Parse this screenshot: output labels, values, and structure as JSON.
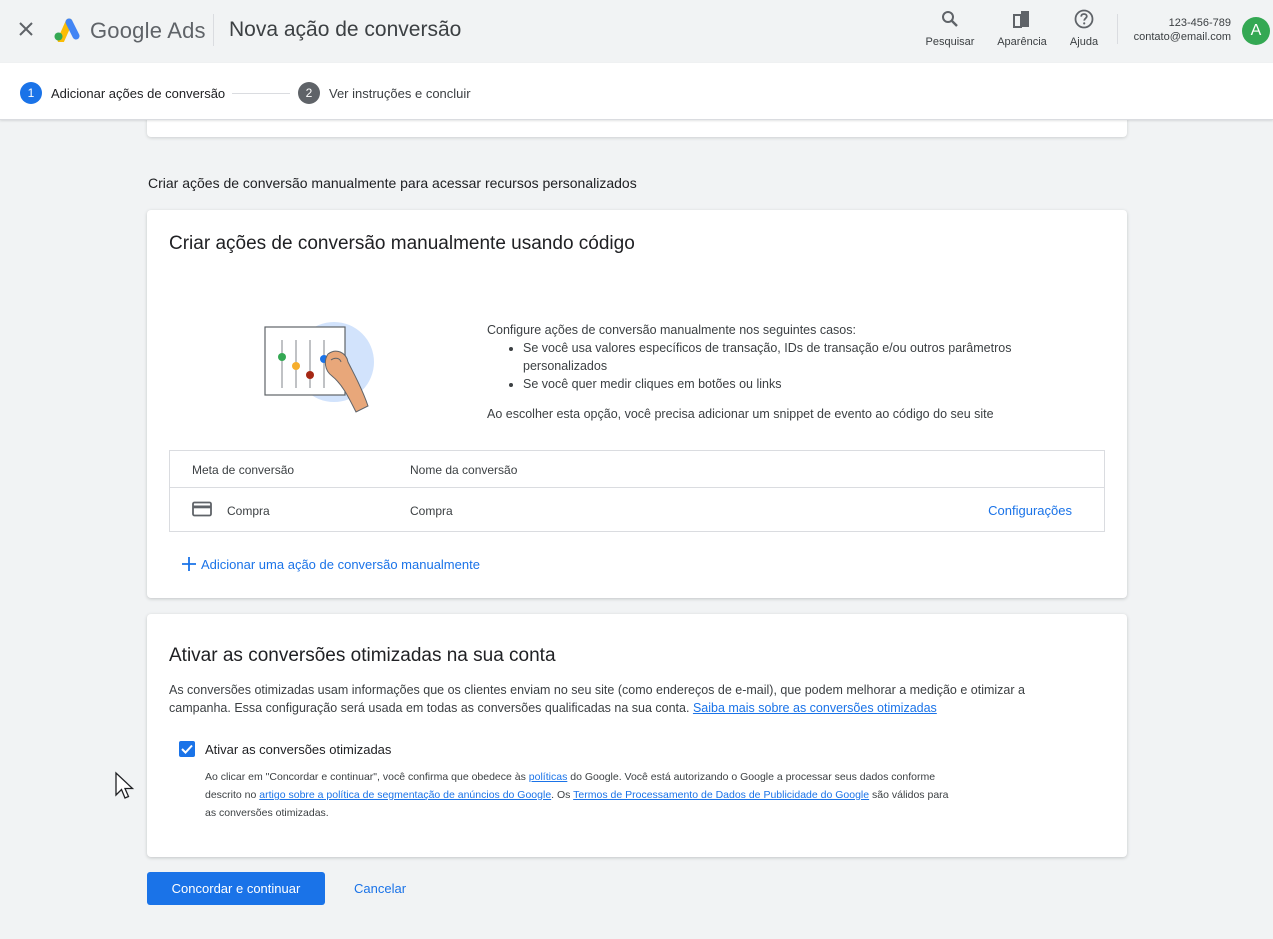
{
  "header": {
    "brand": "Google Ads",
    "page_title": "Nova ação de conversão",
    "tools": [
      {
        "label": "Pesquisar",
        "icon": "search-icon"
      },
      {
        "label": "Aparência",
        "icon": "appearance-icon"
      },
      {
        "label": "Ajuda",
        "icon": "help-icon"
      }
    ],
    "account_id": "123-456-789",
    "account_email": "contato@email.com",
    "avatar_letter": "A"
  },
  "stepper": {
    "steps": [
      {
        "number": "1",
        "label": "Adicionar ações de conversão",
        "active": true
      },
      {
        "number": "2",
        "label": "Ver instruções e concluir",
        "active": false
      }
    ]
  },
  "section_label": "Criar ações de conversão manualmente para acessar recursos personalizados",
  "manual_card": {
    "title": "Criar ações de conversão manualmente usando código",
    "intro": "Configure ações de conversão manualmente nos seguintes casos:",
    "bullets": [
      "Se você usa valores específicos de transação, IDs de transação e/ou outros parâmetros personalizados",
      "Se você quer medir cliques em botões ou links"
    ],
    "note": "Ao escolher esta opção, você precisa adicionar um snippet de evento ao código do seu site",
    "table": {
      "headers": [
        "Meta de conversão",
        "Nome da conversão"
      ],
      "rows": [
        {
          "goal": "Compra",
          "name": "Compra",
          "action": "Configurações",
          "icon": "credit-card-icon"
        }
      ]
    },
    "add_action": "Adicionar uma ação de conversão manualmente"
  },
  "enhanced_card": {
    "title": "Ativar as conversões otimizadas na sua conta",
    "paragraph": "As conversões otimizadas usam informações que os clientes enviam no seu site (como endereços de e-mail), que podem melhorar a medição e otimizar a campanha. Essa configuração será usada em todas as conversões qualificadas na sua conta.",
    "learn_more": "Saiba mais sobre as conversões otimizadas",
    "checkbox_label": "Ativar as conversões otimizadas",
    "checkbox_checked": true,
    "legal": {
      "part1": "Ao clicar em \"Concordar e continuar\", você confirma que obedece às",
      "link1": "políticas",
      "part2": "do Google. Você está autorizando o Google a processar seus dados conforme descrito no",
      "link2": "artigo sobre a política de segmentação de anúncios do Google",
      "part3": ". Os",
      "link3": "Termos de Processamento de Dados de Publicidade do Google",
      "part4": "são válidos para as conversões otimizadas."
    }
  },
  "actions": {
    "primary": "Concordar e continuar",
    "cancel": "Cancelar"
  },
  "colors": {
    "accent": "#1a73e8",
    "avatar": "#34a853",
    "background": "#f1f3f4"
  }
}
